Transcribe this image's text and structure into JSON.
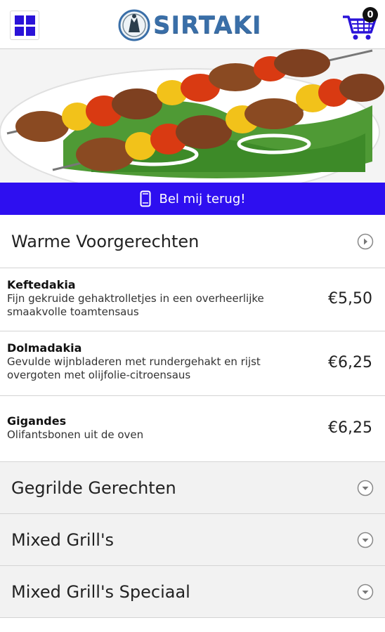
{
  "header": {
    "logo_text": "SIRTAKI",
    "cart_count": "0"
  },
  "callback": {
    "label": "Bel mij terug!"
  },
  "categories": [
    {
      "label": "Warme Voorgerechten",
      "expanded": true,
      "items": [
        {
          "name": "Keftedakia",
          "description": "Fijn gekruide gehaktrolletjes in een overheerlijke smaakvolle toamtensaus",
          "price": "€5,50"
        },
        {
          "name": "Dolmadakia",
          "description": "Gevulde wijnbladeren met rundergehakt en rijst overgoten met olijfolie-citroensaus",
          "price": "€6,25"
        },
        {
          "name": "Gigandes",
          "description": "Olifantsbonen uit de oven",
          "price": "€6,25"
        }
      ]
    },
    {
      "label": "Gegrilde Gerechten",
      "expanded": false
    },
    {
      "label": "Mixed Grill's",
      "expanded": false
    },
    {
      "label": "Mixed Grill's Speciaal",
      "expanded": false
    }
  ],
  "icons": {
    "menu": "grid-menu-icon",
    "cart": "shopping-cart-icon",
    "phone": "mobile-phone-icon",
    "expanded": "chevron-right-circle-icon",
    "collapsed": "chevron-down-circle-icon"
  },
  "colors": {
    "accent": "#2e0ff0",
    "logo": "#3a6fa8"
  }
}
